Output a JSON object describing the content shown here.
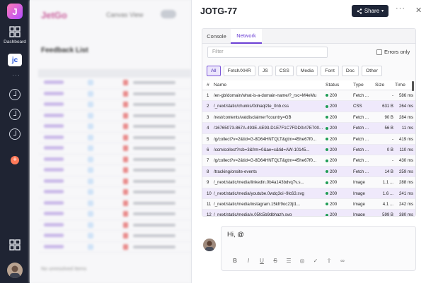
{
  "rail": {
    "logo": "J",
    "dashboard_label": "Dashboard",
    "active_label": "jc"
  },
  "background": {
    "brand": "JetGo",
    "canvas_view_label": "Canvas View",
    "list_title": "Feedback List",
    "footer": "No unresolved Items"
  },
  "panel": {
    "title": "JOTG-77",
    "share_label": "Share"
  },
  "devtools": {
    "tabs": [
      "Console",
      "Network"
    ],
    "active_tab": "Network",
    "filter_placeholder": "Filter",
    "errors_only_label": "Errors only",
    "type_filters": [
      "All",
      "Fetch/XHR",
      "JS",
      "CSS",
      "Media",
      "Font",
      "Doc",
      "Other"
    ],
    "active_type": "All",
    "columns": [
      "#",
      "Name",
      "Status",
      "Type",
      "Size",
      "Time"
    ],
    "rows": [
      {
        "n": "1",
        "name": "/en-gb/domain/what-is-a-domain-name/?_rsc=M4eMu",
        "status": "200",
        "type": "Fetch ...",
        "size": "-",
        "time": "586 ms"
      },
      {
        "n": "2",
        "name": "/_next/static/chunks/0dnaqlzte_0nb.css",
        "status": "200",
        "type": "CSS",
        "size": "631 B",
        "time": "264 ms"
      },
      {
        "n": "3",
        "name": "/rest/contents/vatdisclaimer?country=GB",
        "status": "200",
        "type": "Fetch ...",
        "size": "90 B",
        "time": "284 ms"
      },
      {
        "n": "4",
        "name": "/16765073-867A-493E-AE93-D1E7F1C7FDD0/47E700...",
        "status": "200",
        "type": "Fetch ...",
        "size": "56 B",
        "time": "11 ms"
      },
      {
        "n": "5",
        "name": "/g/collect?v=2&tid=G-8D64HNTQLT&gtm=45he67f0...",
        "status": "200",
        "type": "Fetch ...",
        "size": "-",
        "time": "419 ms"
      },
      {
        "n": "6",
        "name": "/ccm/collect?rcb=3&frm=0&ae=c&tid=AW-10145...",
        "status": "200",
        "type": "Fetch ...",
        "size": "0 B",
        "time": "110 ms"
      },
      {
        "n": "7",
        "name": "/g/collect?v=2&tid=G-8D64HNTQLT&gtm=45he67f0...",
        "status": "200",
        "type": "Fetch ...",
        "size": "-",
        "time": "430 ms"
      },
      {
        "n": "8",
        "name": "/tracking/onsite-events",
        "status": "200",
        "type": "Fetch ...",
        "size": "14 B",
        "time": "259 ms"
      },
      {
        "n": "9",
        "name": "/_next/static/media/linkedin.0b4a143bdvq7v.s...",
        "status": "200",
        "type": "Image",
        "size": "1.1 ...",
        "time": "288 ms"
      },
      {
        "n": "10",
        "name": "/_next/static/media/youtube.0wdq3oi~9lc63.svg",
        "status": "200",
        "type": "Image",
        "size": "1.6 ...",
        "time": "241 ms"
      },
      {
        "n": "11",
        "name": "/_next/static/media/instagram.15kfr9oc23jl1...",
        "status": "200",
        "type": "Image",
        "size": "4.1 ...",
        "time": "242 ms"
      },
      {
        "n": "12",
        "name": "/_next/static/media/x.05fc5b9dbhazh.svg",
        "status": "200",
        "type": "Image",
        "size": "599 B",
        "time": "380 ms"
      }
    ]
  },
  "composer": {
    "text": "Hi, @",
    "tools": [
      "bold-icon",
      "italic-icon",
      "underline-icon",
      "strikethrough-icon",
      "list-icon",
      "task-icon",
      "checkmark-icon",
      "upload-icon",
      "link-icon"
    ]
  },
  "colors": {
    "accent": "#6b3fd4",
    "rail_bg": "#1f2433",
    "status_ok": "#1f9d55"
  }
}
